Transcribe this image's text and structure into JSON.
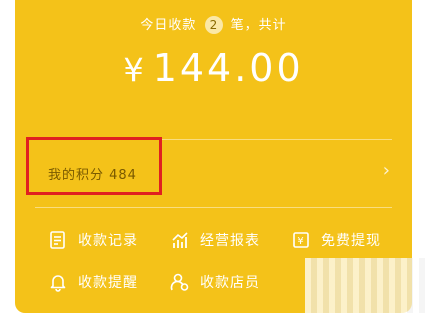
{
  "summary": {
    "prefix": "今日收款",
    "count": "2",
    "suffix": "笔，共计"
  },
  "amount": {
    "currency": "¥",
    "value": "144.00"
  },
  "points": {
    "label": "我的积分 484"
  },
  "actions": [
    {
      "label": "收款记录",
      "icon": "document-icon"
    },
    {
      "label": "经营报表",
      "icon": "chart-icon"
    },
    {
      "label": "免费提现",
      "icon": "withdraw-icon"
    },
    {
      "label": "收款提醒",
      "icon": "bell-icon"
    },
    {
      "label": "收款店员",
      "icon": "staff-icon"
    }
  ],
  "colors": {
    "card": "#F4C219",
    "highlight": "#E02020"
  }
}
